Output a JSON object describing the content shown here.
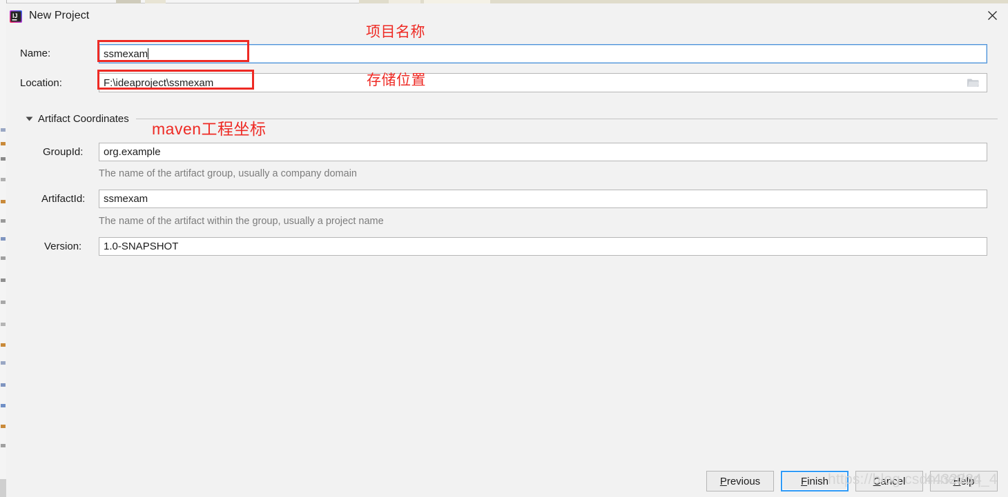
{
  "window": {
    "title": "New Project",
    "logo_icon": "intellij-idea-logo",
    "close_icon": "close-icon"
  },
  "form": {
    "name": {
      "label": "Name:",
      "value": "ssmexam",
      "placeholder": ""
    },
    "location": {
      "label": "Location:",
      "value": "F:\\ideaproject\\ssmexam",
      "placeholder": "",
      "browse_icon": "folder-icon"
    }
  },
  "section": {
    "title": "Artifact Coordinates",
    "expanded": true,
    "toggle_icon": "chevron-down-icon"
  },
  "coordinates": {
    "group_id": {
      "label": "GroupId:",
      "value": "org.example",
      "hint": "The name of the artifact group, usually a company domain"
    },
    "artifact_id": {
      "label": "ArtifactId:",
      "value": "ssmexam",
      "hint": "The name of the artifact within the group, usually a project name"
    },
    "version": {
      "label": "Version:",
      "value": "1.0-SNAPSHOT",
      "hint": ""
    }
  },
  "annotations": {
    "color": "#ee2a24",
    "name_note": "项目名称",
    "location_note": "存储位置",
    "coordinates_note": "maven工程坐标"
  },
  "buttons": {
    "previous": {
      "prefix": "",
      "mnemonic": "P",
      "suffix": "revious"
    },
    "finish": {
      "prefix": "",
      "mnemonic": "F",
      "suffix": "inish"
    },
    "cancel": {
      "prefix": "",
      "mnemonic": "C",
      "suffix": "ancel"
    },
    "help": {
      "prefix": "",
      "mnemonic": "H",
      "suffix": "elp"
    }
  },
  "watermark": {
    "part1": "https://blog.csdn.net/qq_4",
    "part2": "4432334"
  },
  "colors": {
    "dialog_bg": "#f2f2f2",
    "field_bg": "#ffffff",
    "focus_blue": "#4a90d9",
    "default_button_blue": "#2f9af7",
    "annotation_red": "#ee2a24",
    "hint_gray": "#7c7c7c"
  }
}
